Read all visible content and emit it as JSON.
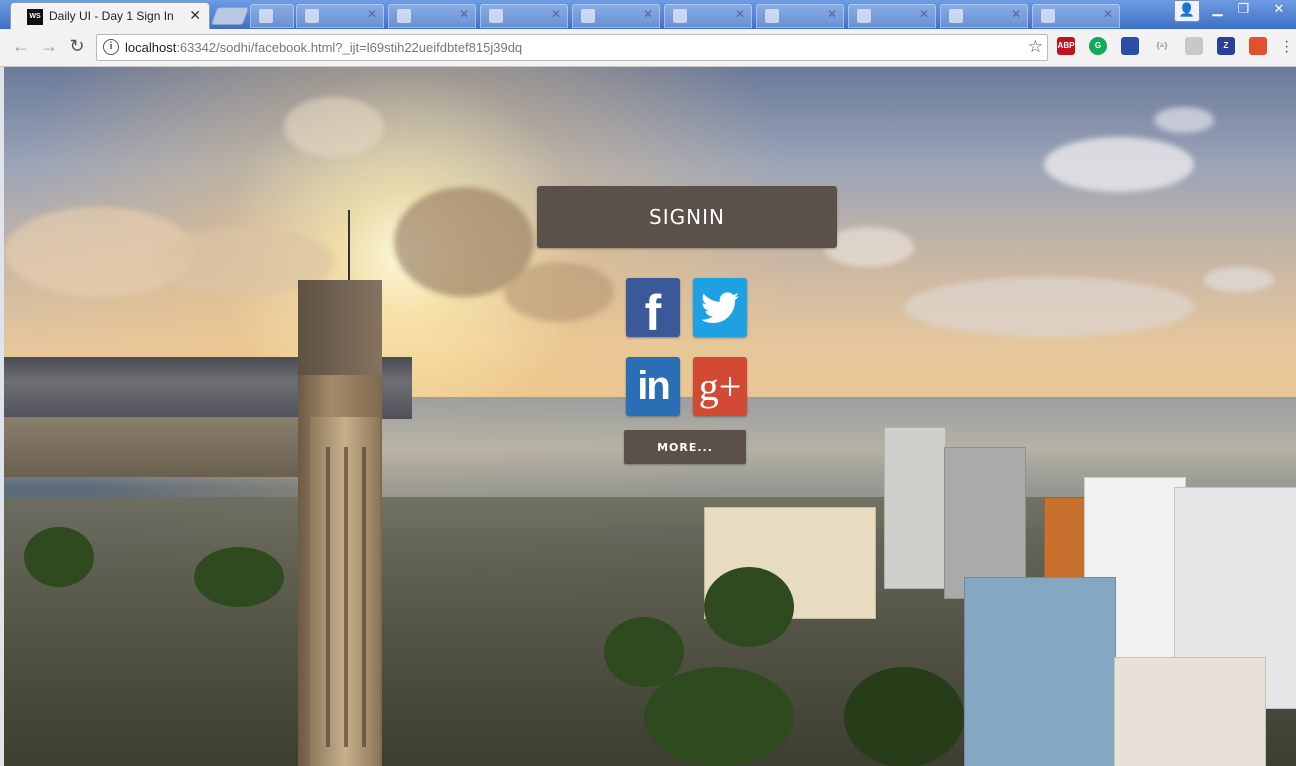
{
  "browser": {
    "active_tab": {
      "title": "Daily UI - Day 1 Sign In",
      "favicon": "WS"
    },
    "url_host": "localhost",
    "url_rest": ":63342/sodhi/facebook.html?_ijt=l69stih22ueifdbtef815j39dq",
    "extensions": [
      {
        "name": "adblock-icon",
        "label": "ABP",
        "color": "#c1121f"
      },
      {
        "name": "grammarly-icon",
        "label": "G",
        "color": "#14a85a"
      },
      {
        "name": "bookmark-ext-icon",
        "label": "",
        "color": "#2c4ea8"
      },
      {
        "name": "json-ext-icon",
        "label": "{≡}",
        "color": "#8a8a8a"
      },
      {
        "name": "feather-ext-icon",
        "label": "",
        "color": "#c8c8c8"
      },
      {
        "name": "zotero-icon",
        "label": "Z",
        "color": "#2b3f9a"
      },
      {
        "name": "puzzle-ext-icon",
        "label": "",
        "color": "#e2512c"
      }
    ]
  },
  "page": {
    "signin_label": "SIGNIN",
    "more_label": "MORE...",
    "social": {
      "facebook": "f",
      "linkedin": "in",
      "googleplus": "g+"
    }
  }
}
